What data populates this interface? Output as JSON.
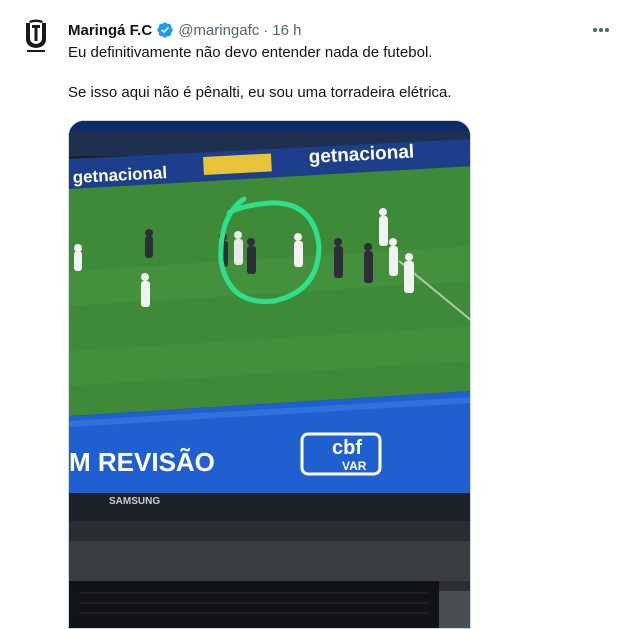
{
  "tweet": {
    "author_name": "Maringá F.C",
    "handle": "@maringafc",
    "separator": "·",
    "time": "16 h",
    "more_icon": "more-horizontal-icon",
    "verified_icon": "verified-badge-icon",
    "line1": "Eu definitivamente não devo entender nada de futebol.",
    "line2": "Se isso aqui não é pênalti, eu sou uma torradeira elétrica."
  },
  "media": {
    "ad_text_1": "getnacional",
    "ad_text_2": "getnacional",
    "banner_text": "M REVISÃO",
    "cbf_text": "cbf",
    "var_text": "VAR",
    "tv_brand": "SAMSUNG",
    "highlight_color": "#2fe08a",
    "banner_color": "#1f5fcf",
    "pitch_color": "#3e8a38"
  },
  "colors": {
    "accent_blue": "#1d9bf0",
    "text_primary": "#0f1419",
    "text_secondary": "#536471"
  }
}
